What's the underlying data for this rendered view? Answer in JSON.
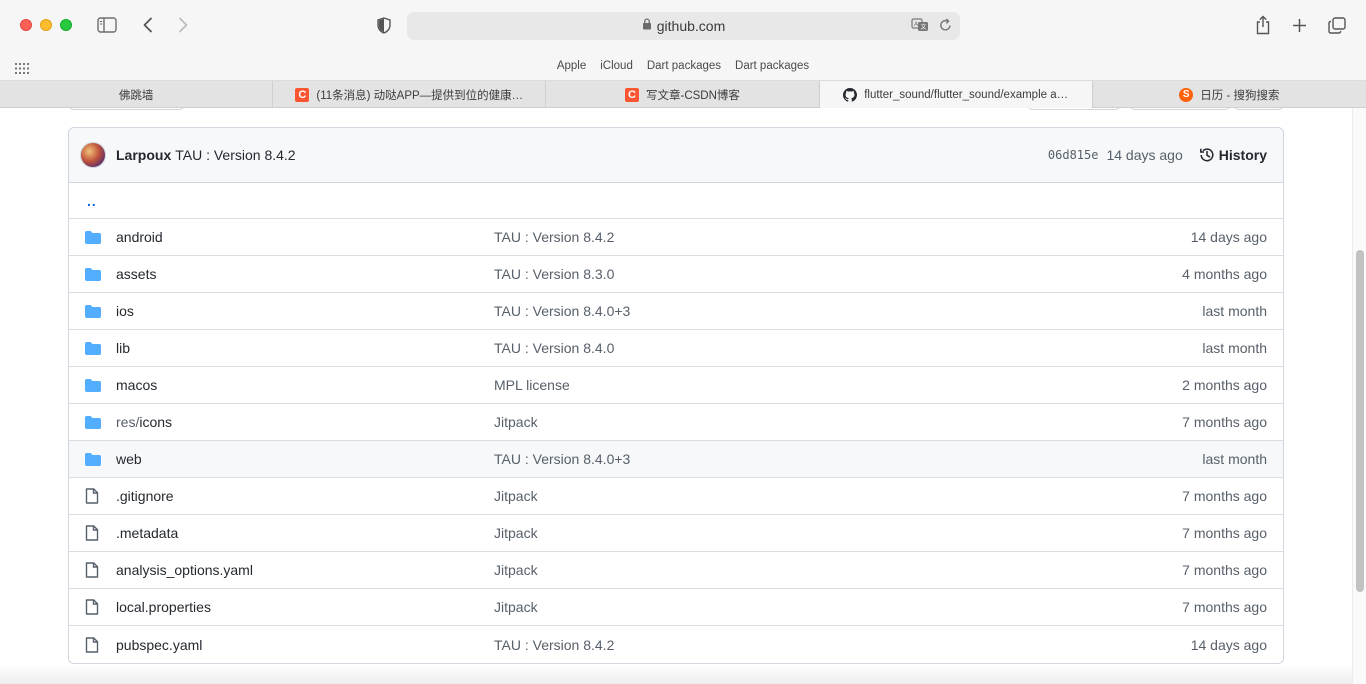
{
  "browser": {
    "url": "github.com",
    "favorites": [
      "Apple",
      "iCloud",
      "Dart packages",
      "Dart packages"
    ],
    "tabs": [
      {
        "title": "佛跳墙",
        "icon": "none",
        "active": false
      },
      {
        "title": "(11条消息) 动哒APP—提供到位的健康…",
        "icon": "csdn-icon",
        "active": false
      },
      {
        "title": "写文章-CSDN博客",
        "icon": "csdn-icon",
        "active": false
      },
      {
        "title": "flutter_sound/flutter_sound/example a…",
        "icon": "github-icon",
        "active": true
      },
      {
        "title": "日历 - 搜狗搜索",
        "icon": "sogou-icon",
        "active": false
      }
    ]
  },
  "commit": {
    "author": "Larpoux",
    "message": "TAU : Version 8.4.2",
    "sha": "06d815e",
    "age": "14 days ago",
    "history_label": "History"
  },
  "parent_dir": "..",
  "files": [
    {
      "type": "dir",
      "name": "android",
      "prefix": "",
      "message": "TAU : Version 8.4.2",
      "age": "14 days ago"
    },
    {
      "type": "dir",
      "name": "assets",
      "prefix": "",
      "message": "TAU : Version 8.3.0",
      "age": "4 months ago"
    },
    {
      "type": "dir",
      "name": "ios",
      "prefix": "",
      "message": "TAU : Version 8.4.0+3",
      "age": "last month"
    },
    {
      "type": "dir",
      "name": "lib",
      "prefix": "",
      "message": "TAU : Version 8.4.0",
      "age": "last month"
    },
    {
      "type": "dir",
      "name": "macos",
      "prefix": "",
      "message": "MPL license",
      "age": "2 months ago"
    },
    {
      "type": "dir",
      "name": "icons",
      "prefix": "res/",
      "message": "Jitpack",
      "age": "7 months ago"
    },
    {
      "type": "dir",
      "name": "web",
      "prefix": "",
      "message": "TAU : Version 8.4.0+3",
      "age": "last month",
      "hover": true
    },
    {
      "type": "file",
      "name": ".gitignore",
      "prefix": "",
      "message": "Jitpack",
      "age": "7 months ago"
    },
    {
      "type": "file",
      "name": ".metadata",
      "prefix": "",
      "message": "Jitpack",
      "age": "7 months ago"
    },
    {
      "type": "file",
      "name": "analysis_options.yaml",
      "prefix": "",
      "message": "Jitpack",
      "age": "7 months ago"
    },
    {
      "type": "file",
      "name": "local.properties",
      "prefix": "",
      "message": "Jitpack",
      "age": "7 months ago"
    },
    {
      "type": "file",
      "name": "pubspec.yaml",
      "prefix": "",
      "message": "TAU : Version 8.4.2",
      "age": "14 days ago"
    }
  ],
  "colors": {
    "folder": "#54aeff",
    "file_icon": "#57606a",
    "link": "#0969da"
  }
}
